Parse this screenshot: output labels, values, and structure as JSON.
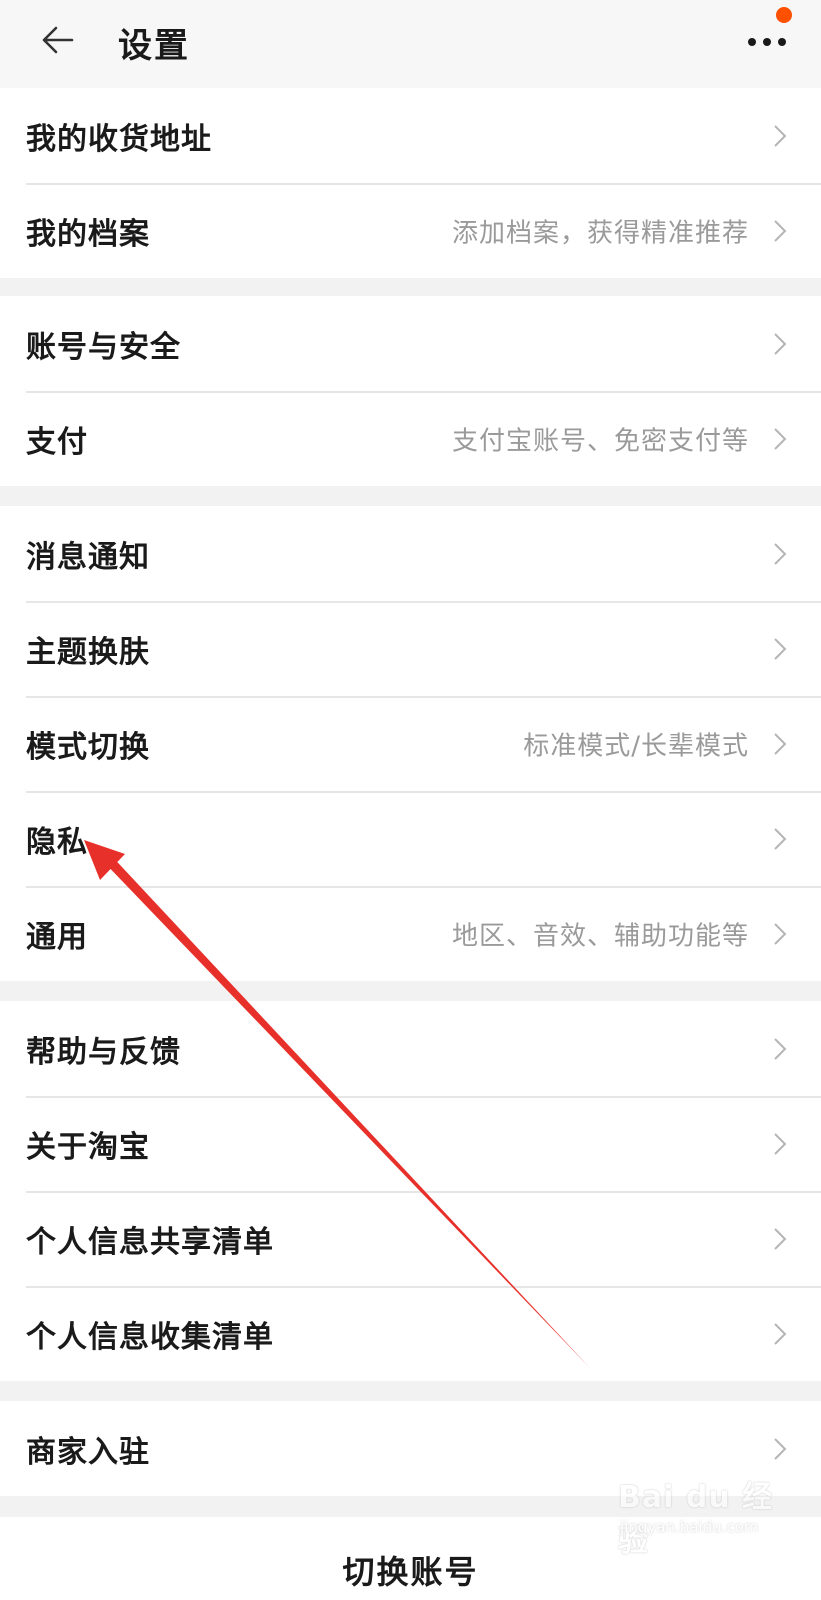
{
  "header": {
    "title": "设置",
    "back_icon": "arrow-left-icon",
    "more_icon": "more-dots-icon",
    "notification_dot_color": "#ff5000"
  },
  "groups": [
    {
      "items": [
        {
          "label": "我的收货地址",
          "hint": ""
        },
        {
          "label": "我的档案",
          "hint": "添加档案，获得精准推荐"
        }
      ]
    },
    {
      "items": [
        {
          "label": "账号与安全",
          "hint": ""
        },
        {
          "label": "支付",
          "hint": "支付宝账号、免密支付等"
        }
      ]
    },
    {
      "items": [
        {
          "label": "消息通知",
          "hint": ""
        },
        {
          "label": "主题换肤",
          "hint": ""
        },
        {
          "label": "模式切换",
          "hint": "标准模式/长辈模式"
        },
        {
          "label": "隐私",
          "hint": ""
        },
        {
          "label": "通用",
          "hint": "地区、音效、辅助功能等"
        }
      ]
    },
    {
      "items": [
        {
          "label": "帮助与反馈",
          "hint": ""
        },
        {
          "label": "关于淘宝",
          "hint": ""
        },
        {
          "label": "个人信息共享清单",
          "hint": ""
        },
        {
          "label": "个人信息收集清单",
          "hint": ""
        }
      ]
    },
    {
      "items": [
        {
          "label": "商家入驻",
          "hint": ""
        }
      ]
    }
  ],
  "bottom": {
    "switch_account_label": "切换账号"
  },
  "annotation": {
    "color": "#e8302a",
    "points_to": "隐私"
  },
  "watermark": {
    "logo_text": "Bai du 经验",
    "url_text": "jingyan.baidu.com"
  }
}
